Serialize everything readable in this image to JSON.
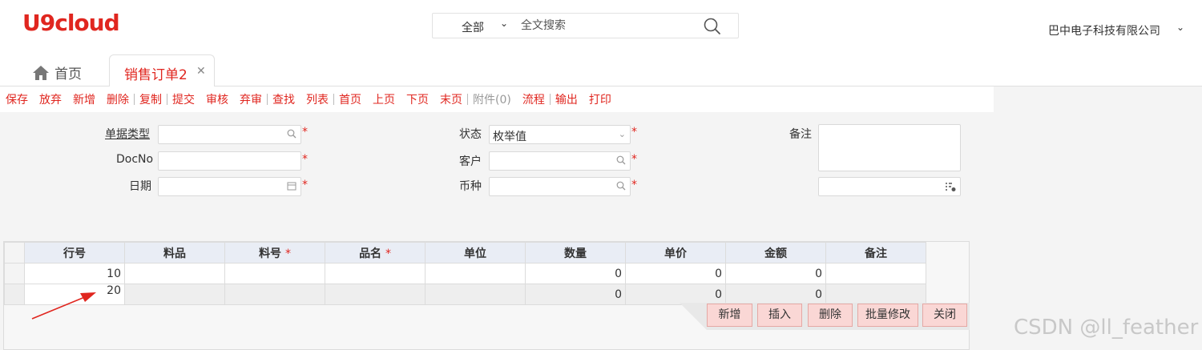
{
  "header": {
    "logo": "U9cloud",
    "search_scope": "全部",
    "search_placeholder": "全文搜索",
    "company": "巴中电子科技有限公司"
  },
  "tabs": {
    "home": "首页",
    "active": "销售订单2"
  },
  "toolbar": {
    "items": [
      "保存",
      "放弃",
      "新增",
      "删除",
      "复制",
      "提交",
      "审核",
      "弃审",
      "查找",
      "列表",
      "首页",
      "上页",
      "下页",
      "末页",
      "附件(0)",
      "流程",
      "输出",
      "打印"
    ]
  },
  "form": {
    "doc_type_label": "单据类型",
    "docno_label": "DocNo",
    "date_label": "日期",
    "status_label": "状态",
    "status_value": "枚举值",
    "customer_label": "客户",
    "currency_label": "币种",
    "remark_label": "备注",
    "required_mark": "*"
  },
  "grid": {
    "headers": [
      "行号",
      "料品",
      "料号",
      "品名",
      "单位",
      "数量",
      "单价",
      "金额",
      "备注"
    ],
    "rows": [
      {
        "line": "10",
        "qty": "0",
        "price": "0",
        "amount": "0"
      },
      {
        "line": "20",
        "qty": "0",
        "price": "0",
        "amount": "0"
      }
    ],
    "buttons": [
      "新增",
      "插入",
      "删除",
      "批量修改",
      "关闭"
    ]
  },
  "watermark": "CSDN @ll_feather",
  "colors": {
    "accent": "#e0261f",
    "grid_header": "#e9edf5",
    "button_bg": "#fad7d5"
  }
}
